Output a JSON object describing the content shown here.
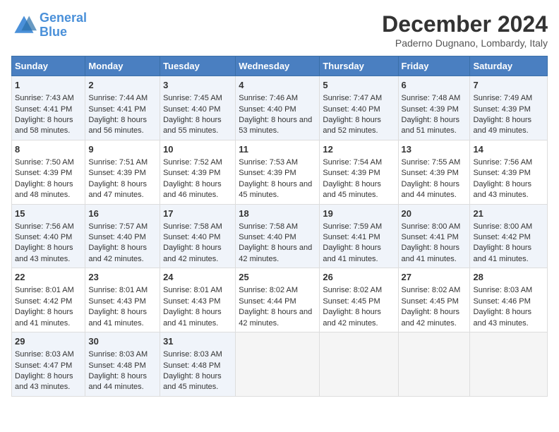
{
  "logo": {
    "line1": "General",
    "line2": "Blue"
  },
  "title": "December 2024",
  "location": "Paderno Dugnano, Lombardy, Italy",
  "headers": [
    "Sunday",
    "Monday",
    "Tuesday",
    "Wednesday",
    "Thursday",
    "Friday",
    "Saturday"
  ],
  "weeks": [
    [
      {
        "day": "1",
        "sunrise": "7:43 AM",
        "sunset": "4:41 PM",
        "daylight": "8 hours and 58 minutes."
      },
      {
        "day": "2",
        "sunrise": "7:44 AM",
        "sunset": "4:41 PM",
        "daylight": "8 hours and 56 minutes."
      },
      {
        "day": "3",
        "sunrise": "7:45 AM",
        "sunset": "4:40 PM",
        "daylight": "8 hours and 55 minutes."
      },
      {
        "day": "4",
        "sunrise": "7:46 AM",
        "sunset": "4:40 PM",
        "daylight": "8 hours and 53 minutes."
      },
      {
        "day": "5",
        "sunrise": "7:47 AM",
        "sunset": "4:40 PM",
        "daylight": "8 hours and 52 minutes."
      },
      {
        "day": "6",
        "sunrise": "7:48 AM",
        "sunset": "4:39 PM",
        "daylight": "8 hours and 51 minutes."
      },
      {
        "day": "7",
        "sunrise": "7:49 AM",
        "sunset": "4:39 PM",
        "daylight": "8 hours and 49 minutes."
      }
    ],
    [
      {
        "day": "8",
        "sunrise": "7:50 AM",
        "sunset": "4:39 PM",
        "daylight": "8 hours and 48 minutes."
      },
      {
        "day": "9",
        "sunrise": "7:51 AM",
        "sunset": "4:39 PM",
        "daylight": "8 hours and 47 minutes."
      },
      {
        "day": "10",
        "sunrise": "7:52 AM",
        "sunset": "4:39 PM",
        "daylight": "8 hours and 46 minutes."
      },
      {
        "day": "11",
        "sunrise": "7:53 AM",
        "sunset": "4:39 PM",
        "daylight": "8 hours and 45 minutes."
      },
      {
        "day": "12",
        "sunrise": "7:54 AM",
        "sunset": "4:39 PM",
        "daylight": "8 hours and 45 minutes."
      },
      {
        "day": "13",
        "sunrise": "7:55 AM",
        "sunset": "4:39 PM",
        "daylight": "8 hours and 44 minutes."
      },
      {
        "day": "14",
        "sunrise": "7:56 AM",
        "sunset": "4:39 PM",
        "daylight": "8 hours and 43 minutes."
      }
    ],
    [
      {
        "day": "15",
        "sunrise": "7:56 AM",
        "sunset": "4:40 PM",
        "daylight": "8 hours and 43 minutes."
      },
      {
        "day": "16",
        "sunrise": "7:57 AM",
        "sunset": "4:40 PM",
        "daylight": "8 hours and 42 minutes."
      },
      {
        "day": "17",
        "sunrise": "7:58 AM",
        "sunset": "4:40 PM",
        "daylight": "8 hours and 42 minutes."
      },
      {
        "day": "18",
        "sunrise": "7:58 AM",
        "sunset": "4:40 PM",
        "daylight": "8 hours and 42 minutes."
      },
      {
        "day": "19",
        "sunrise": "7:59 AM",
        "sunset": "4:41 PM",
        "daylight": "8 hours and 41 minutes."
      },
      {
        "day": "20",
        "sunrise": "8:00 AM",
        "sunset": "4:41 PM",
        "daylight": "8 hours and 41 minutes."
      },
      {
        "day": "21",
        "sunrise": "8:00 AM",
        "sunset": "4:42 PM",
        "daylight": "8 hours and 41 minutes."
      }
    ],
    [
      {
        "day": "22",
        "sunrise": "8:01 AM",
        "sunset": "4:42 PM",
        "daylight": "8 hours and 41 minutes."
      },
      {
        "day": "23",
        "sunrise": "8:01 AM",
        "sunset": "4:43 PM",
        "daylight": "8 hours and 41 minutes."
      },
      {
        "day": "24",
        "sunrise": "8:01 AM",
        "sunset": "4:43 PM",
        "daylight": "8 hours and 41 minutes."
      },
      {
        "day": "25",
        "sunrise": "8:02 AM",
        "sunset": "4:44 PM",
        "daylight": "8 hours and 42 minutes."
      },
      {
        "day": "26",
        "sunrise": "8:02 AM",
        "sunset": "4:45 PM",
        "daylight": "8 hours and 42 minutes."
      },
      {
        "day": "27",
        "sunrise": "8:02 AM",
        "sunset": "4:45 PM",
        "daylight": "8 hours and 42 minutes."
      },
      {
        "day": "28",
        "sunrise": "8:03 AM",
        "sunset": "4:46 PM",
        "daylight": "8 hours and 43 minutes."
      }
    ],
    [
      {
        "day": "29",
        "sunrise": "8:03 AM",
        "sunset": "4:47 PM",
        "daylight": "8 hours and 43 minutes."
      },
      {
        "day": "30",
        "sunrise": "8:03 AM",
        "sunset": "4:48 PM",
        "daylight": "8 hours and 44 minutes."
      },
      {
        "day": "31",
        "sunrise": "8:03 AM",
        "sunset": "4:48 PM",
        "daylight": "8 hours and 45 minutes."
      },
      null,
      null,
      null,
      null
    ]
  ]
}
